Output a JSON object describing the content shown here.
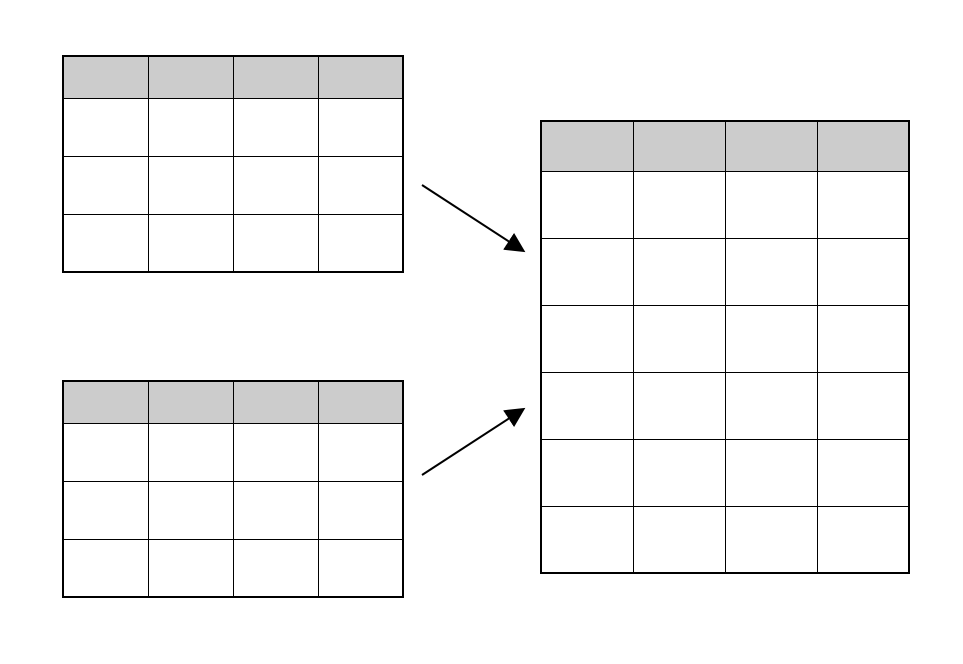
{
  "diagram": {
    "tables": {
      "topLeft": {
        "columns": 4,
        "headerRows": 1,
        "dataRows": 3
      },
      "bottomLeft": {
        "columns": 4,
        "headerRows": 1,
        "dataRows": 3
      },
      "right": {
        "columns": 4,
        "headerRows": 1,
        "dataRows": 6
      }
    },
    "colors": {
      "headerBackground": "#cccccc",
      "cellBackground": "#ffffff",
      "border": "#000000"
    },
    "arrows": [
      {
        "from": "topLeft",
        "to": "right"
      },
      {
        "from": "bottomLeft",
        "to": "right"
      }
    ]
  }
}
